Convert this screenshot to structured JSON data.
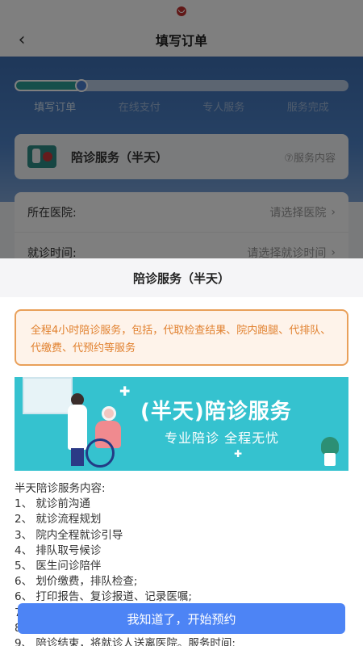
{
  "header": {
    "title": "填写订单",
    "back_icon": "chevron-left-icon"
  },
  "progress": {
    "value_fraction": 0.2,
    "steps": [
      {
        "label": "填写订单",
        "active": true
      },
      {
        "label": "在线支付",
        "active": false
      },
      {
        "label": "专人服务",
        "active": false
      },
      {
        "label": "服务完成",
        "active": false
      }
    ]
  },
  "service": {
    "name": "陪诊服务（半天）",
    "detail_link": "⑦服务内容"
  },
  "form": {
    "hospital_label": "所在医院:",
    "hospital_value": "请选择医院",
    "time_label": "就诊时间:",
    "time_value": "请选择就诊时间"
  },
  "sheet": {
    "title": "陪诊服务（半天）",
    "notice": "全程4小时陪诊服务，包括，代取检查结果、院内跑腿、代排队、代缴费、代预约等服务",
    "banner_title": "(半天)陪诊服务",
    "banner_subtitle": "专业陪诊  全程无忧",
    "content_lines": [
      "半天陪诊服务内容:",
      "1、 就诊前沟通",
      "2、 就诊流程规划",
      "3、 院内全程就诊引导",
      "4、 排队取号候诊",
      "5、 医生问诊陪伴",
      "6、 划价缴费，排队检查;",
      "6、 打印报告、复诊报道、记录医嘱;",
      "7、",
      "8、",
      "9、 陪诊结束，将就诊人送离医院。服务时间:"
    ],
    "confirm_button": "我知道了，开始预约"
  },
  "colors": {
    "accent": "#4d84f5",
    "hero_blue": "#3d6fb3",
    "notice_orange": "#e1812f",
    "banner_teal": "#35c2cf"
  }
}
